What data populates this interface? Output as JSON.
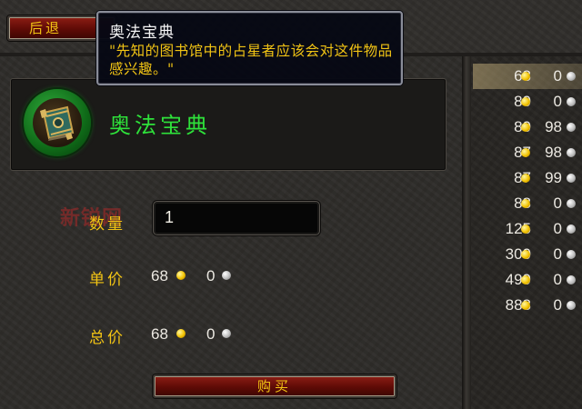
{
  "header": {
    "back_label": "后退"
  },
  "tooltip": {
    "title": "奥法宝典",
    "description": "\"先知的图书馆中的占星者应该会对这件物品感兴趣。\""
  },
  "item": {
    "name": "奥法宝典",
    "icon": "tome-icon"
  },
  "form": {
    "quantity_label": "数量",
    "quantity_value": "1",
    "unit_price_label": "单价",
    "unit_price": {
      "gold": "68",
      "silver": "0"
    },
    "total_price_label": "总价",
    "total_price": {
      "gold": "68",
      "silver": "0"
    },
    "buy_label": "购买"
  },
  "price_list": [
    {
      "gold": "68",
      "silver": "0"
    },
    {
      "gold": "80",
      "silver": "0"
    },
    {
      "gold": "80",
      "silver": "98"
    },
    {
      "gold": "87",
      "silver": "98"
    },
    {
      "gold": "87",
      "silver": "99"
    },
    {
      "gold": "88",
      "silver": "0"
    },
    {
      "gold": "125",
      "silver": "0"
    },
    {
      "gold": "300",
      "silver": "0"
    },
    {
      "gold": "499",
      "silver": "0"
    },
    {
      "gold": "888",
      "silver": "0"
    }
  ],
  "selected_price_index": 0,
  "watermark": "新锐网",
  "colors": {
    "label_gold": "#f2c414",
    "item_green": "#2ee13a",
    "button_red": "#5e0b06"
  }
}
